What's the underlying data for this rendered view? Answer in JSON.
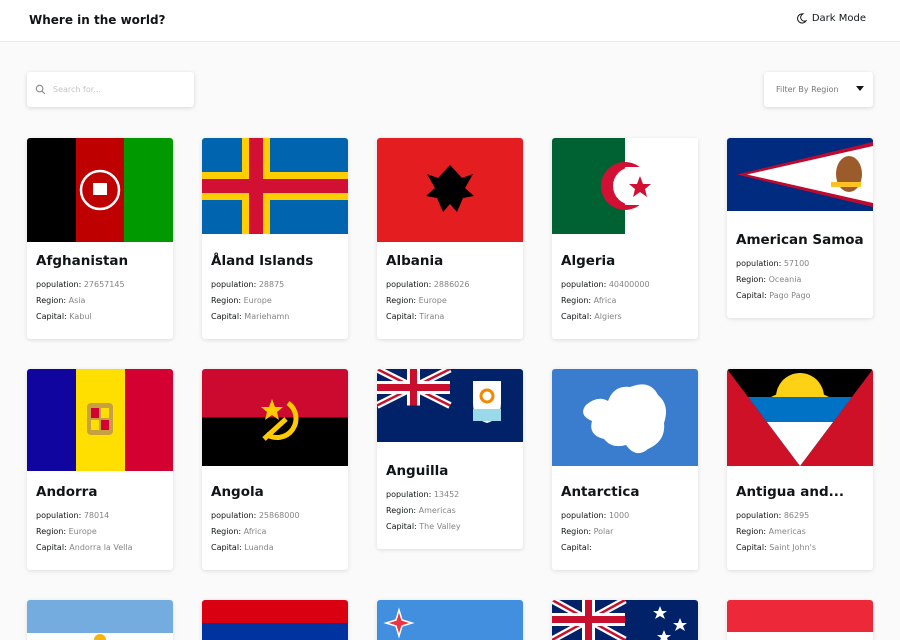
{
  "header": {
    "title": "Where in the world?",
    "dark_mode_label": "Dark Mode"
  },
  "search": {
    "placeholder": "Search for...",
    "value": ""
  },
  "filter": {
    "label": "Filter By Region"
  },
  "labels": {
    "population": "population: ",
    "region": "Region: ",
    "capital": "Capital: "
  },
  "countries": [
    {
      "name": "Afghanistan",
      "population": "27657145",
      "region": "Asia",
      "capital": "Kabul"
    },
    {
      "name": "Åland Islands",
      "population": "28875",
      "region": "Europe",
      "capital": "Mariehamn"
    },
    {
      "name": "Albania",
      "population": "2886026",
      "region": "Europe",
      "capital": "Tirana"
    },
    {
      "name": "Algeria",
      "population": "40400000",
      "region": "Africa",
      "capital": "Algiers"
    },
    {
      "name": "American Samoa",
      "population": "57100",
      "region": "Oceania",
      "capital": "Pago Pago"
    },
    {
      "name": "Andorra",
      "population": "78014",
      "region": "Europe",
      "capital": "Andorra la Vella"
    },
    {
      "name": "Angola",
      "population": "25868000",
      "region": "Africa",
      "capital": "Luanda"
    },
    {
      "name": "Anguilla",
      "population": "13452",
      "region": "Americas",
      "capital": "The Valley"
    },
    {
      "name": "Antarctica",
      "population": "1000",
      "region": "Polar",
      "capital": ""
    },
    {
      "name": "Antigua and...",
      "population": "86295",
      "region": "Americas",
      "capital": "Saint John's"
    }
  ],
  "colors": {
    "background": "#fafafa",
    "card": "#ffffff",
    "text": "#111517",
    "muted": "#858585"
  }
}
